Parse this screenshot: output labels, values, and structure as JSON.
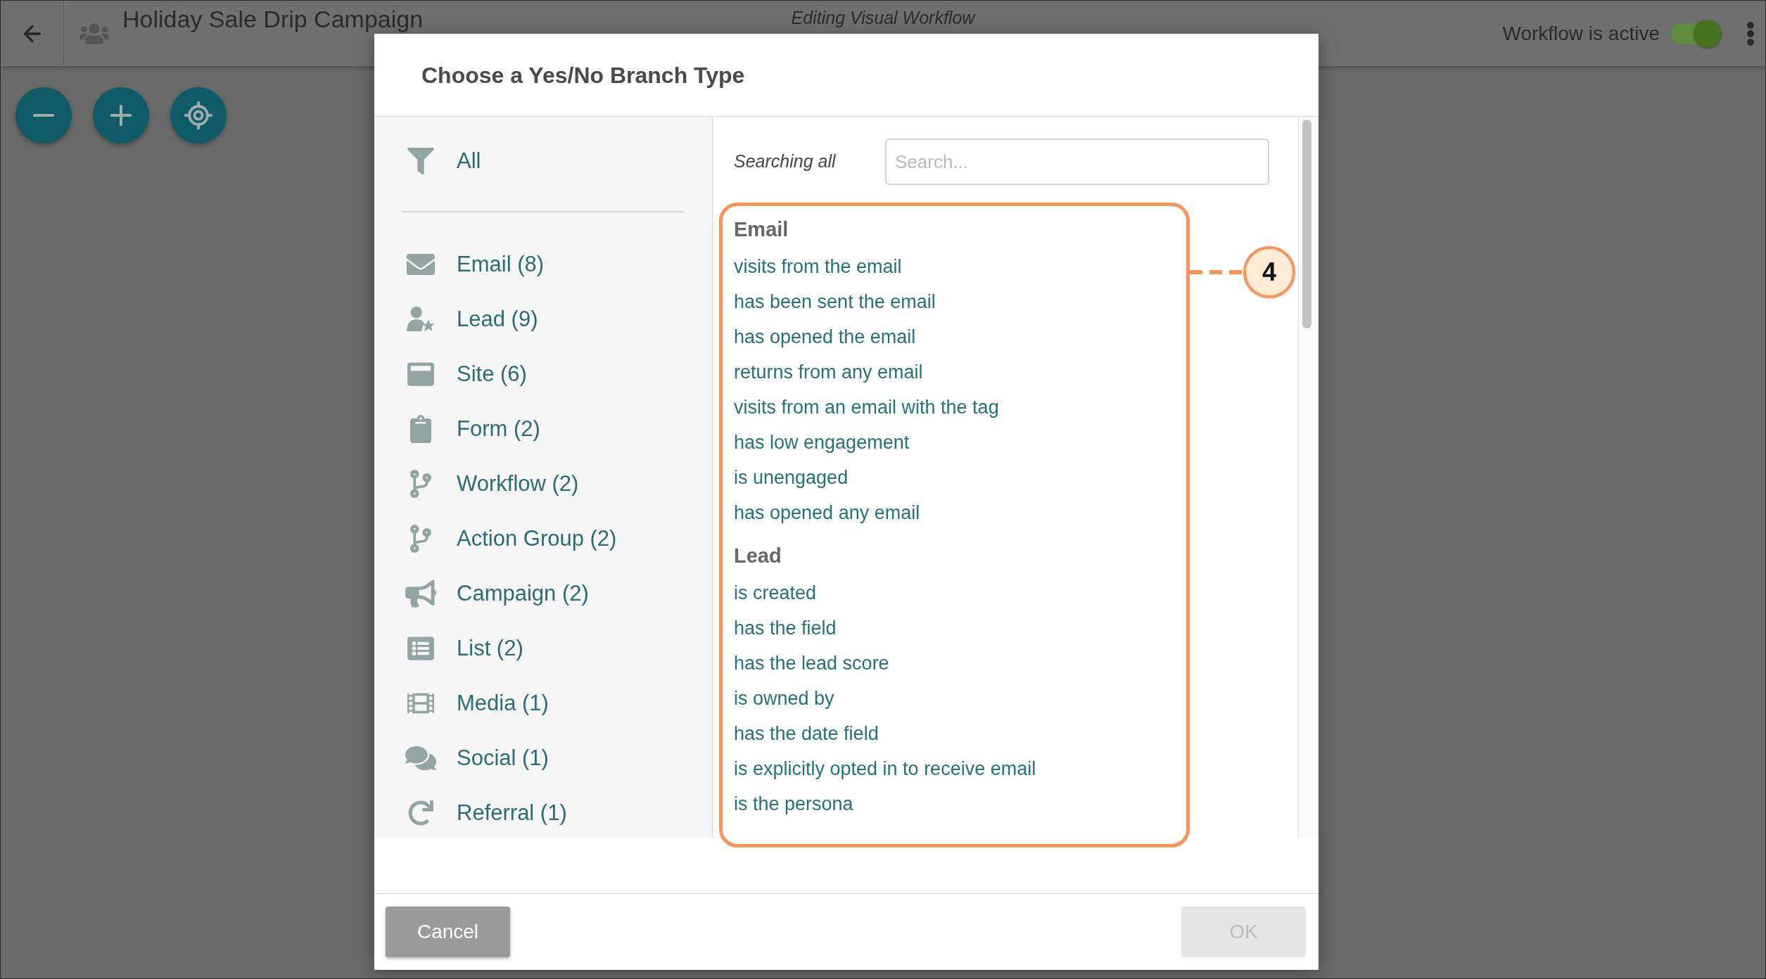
{
  "header": {
    "title": "Holiday Sale Drip Campaign",
    "subtitle": "Editing Visual Workflow",
    "status": {
      "label": "Workflow is active",
      "on": true
    }
  },
  "modal": {
    "title": "Choose a Yes/No Branch Type",
    "sidebar": {
      "all": {
        "label": "All"
      },
      "categories": [
        {
          "kind": "email",
          "label": "Email (8)"
        },
        {
          "kind": "lead",
          "label": "Lead (9)"
        },
        {
          "kind": "site",
          "label": "Site (6)"
        },
        {
          "kind": "form",
          "label": "Form (2)"
        },
        {
          "kind": "workflow",
          "label": "Workflow (2)"
        },
        {
          "kind": "actiongroup",
          "label": "Action Group (2)"
        },
        {
          "kind": "campaign",
          "label": "Campaign (2)"
        },
        {
          "kind": "list",
          "label": "List (2)"
        },
        {
          "kind": "media",
          "label": "Media (1)"
        },
        {
          "kind": "social",
          "label": "Social (1)"
        },
        {
          "kind": "referral",
          "label": "Referral (1)"
        }
      ]
    },
    "search": {
      "scope_label": "Searching all",
      "placeholder": "Search..."
    },
    "groups": [
      {
        "heading": "Email",
        "items": [
          "visits from the email",
          "has been sent the email",
          "has opened the email",
          "returns from any email",
          "visits from an email with the tag",
          "has low engagement",
          "is unengaged",
          "has opened any email"
        ]
      },
      {
        "heading": "Lead",
        "items": [
          "is created",
          "has the field",
          "has the lead score",
          "is owned by",
          "has the date field",
          "is explicitly opted in to receive email",
          "is the persona"
        ]
      }
    ],
    "callout": {
      "number": "4"
    },
    "buttons": [
      {
        "label": "Cancel",
        "disabled": false
      },
      {
        "label": "OK",
        "disabled": true
      }
    ]
  }
}
